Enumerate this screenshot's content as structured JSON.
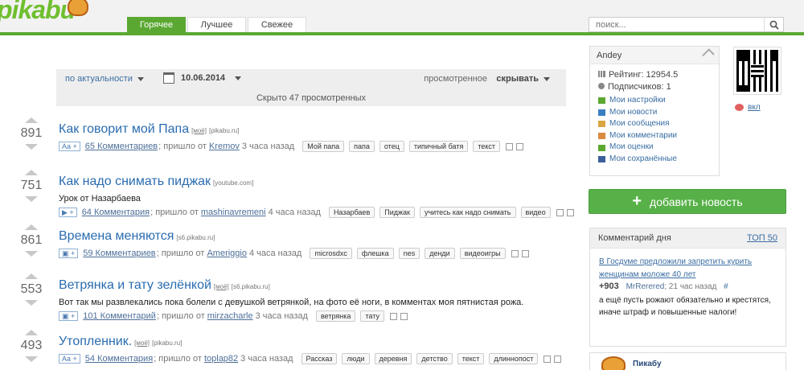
{
  "header": {
    "logo_text": "pikabu",
    "tabs": [
      {
        "label": "Горячее",
        "active": true
      },
      {
        "label": "Лучшее",
        "active": false
      },
      {
        "label": "Свежее",
        "active": false
      }
    ],
    "search_placeholder": "поиск...",
    "accent_color": "#5aa832"
  },
  "filter": {
    "sort_label": "по актуальности",
    "date": "10.06.2014",
    "viewed_label": "просмотренное",
    "hide_label": "скрывать",
    "hidden_text": "Скрыто 47 просмотренных"
  },
  "stories": [
    {
      "rating": "891",
      "title": "Как говорит мой Папа",
      "mine": "[моё]",
      "source": "[pikabu.ru]",
      "desc": "",
      "badge": "Aa +",
      "comments": "65 Комментариев",
      "from_text": "; пришло от",
      "author": "Kremov",
      "time": "3 часа назад",
      "tags": [
        "Мой папа",
        "папа",
        "отец",
        "типичный батя",
        "текст"
      ]
    },
    {
      "rating": "751",
      "title": "Как надо снимать пиджак",
      "mine": "",
      "source": "[youtube.com]",
      "desc": "Урок от Назарбаева",
      "badge": "▶ +",
      "comments": "64 Комментария",
      "from_text": "; пришло от",
      "author": "mashinavremeni",
      "time": "4 часа назад",
      "tags": [
        "Назарбаев",
        "Пиджак",
        "учитесь как надо снимать",
        "видео"
      ]
    },
    {
      "rating": "861",
      "title": "Времена меняются",
      "mine": "",
      "source": "[s6.pikabu.ru]",
      "desc": "",
      "badge": "▣ +",
      "comments": "59 Комментариев",
      "from_text": "; пришло от",
      "author": "Ameriggio",
      "time": "4 часа назад",
      "tags": [
        "microsdxc",
        "флешка",
        "nes",
        "денди",
        "видеоигры"
      ]
    },
    {
      "rating": "553",
      "title": "Ветрянка и тату зелёнкой",
      "mine": "[моё]",
      "source": "[s6.pikabu.ru]",
      "desc": "Вот так мы развлекались пока болели с девушкой ветрянкой, на фото её ноги, в комментах моя пятнистая рожа.",
      "badge": "▣ +",
      "comments": "101 Комментарий",
      "from_text": "; пришло от",
      "author": "mirzacharle",
      "time": "3 часа назад",
      "tags": [
        "ветрянка",
        "тату"
      ]
    },
    {
      "rating": "493",
      "title": "Утопленник.",
      "mine": "[моё]",
      "source": "[pikabu.ru]",
      "desc": "",
      "badge": "Aa +",
      "comments": "54 Комментария",
      "from_text": "; пришло от",
      "author": "toplap82",
      "time": "3 часа назад",
      "tags": [
        "Рассказ",
        "люди",
        "деревня",
        "детство",
        "текст",
        "длиннопост"
      ]
    }
  ],
  "user": {
    "name": "Andey",
    "rating": "Рейтинг: 12954.5",
    "subscribers": "Подписчиков: 1",
    "links": [
      {
        "label": "Мои настройки",
        "icon": "gear-icon",
        "color": "#5aa832"
      },
      {
        "label": "Мои новости",
        "icon": "news-icon",
        "color": "#3a7fc1"
      },
      {
        "label": "Мои сообщения",
        "icon": "envelope-icon",
        "color": "#d9a640"
      },
      {
        "label": "Мои комментарии",
        "icon": "comment-icon",
        "color": "#d98a40"
      },
      {
        "label": "Мои оценки",
        "icon": "rating-icon",
        "color": "#5aa832"
      },
      {
        "label": "Мои сохранённые",
        "icon": "save-icon",
        "color": "#3a5f9a"
      }
    ]
  },
  "vk_label": "вкл",
  "add_button": "добавить новость",
  "comment_of_day": {
    "title": "Комментарий дня",
    "top_label": "ТОП 50",
    "link": "В Госдуме предложили запретить курить женщинам моложе 40 лет",
    "score": "+903",
    "author": "MrRerered",
    "time": "; 21 час назад",
    "hash": "#",
    "text": "а ещё пусть рожают обязательно и крестятся, иначе штраф и повышенные налоги!"
  },
  "pikabu_box": {
    "name": "Пикабу"
  }
}
